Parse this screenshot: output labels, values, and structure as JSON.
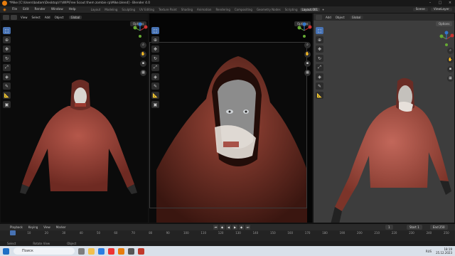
{
  "titlebar": {
    "title": "*Mike [C:\\Users\\badam\\Desktop\\!!\\WIP\\Free Scout them zombie rp\\Mike.blend] - Blender 4.0"
  },
  "menubar": {
    "items": [
      "File",
      "Edit",
      "Render",
      "Window",
      "Help"
    ],
    "workspaces": [
      "Layout",
      "Modeling",
      "Sculpting",
      "UV Editing",
      "Texture Paint",
      "Shading",
      "Animation",
      "Rendering",
      "Compositing",
      "Geometry Nodes",
      "Scripting",
      "Layout.001"
    ],
    "active_workspace": "Layout.001",
    "scene": "Scene",
    "view_layer": "ViewLayer"
  },
  "viewport_header": {
    "items": [
      "View",
      "Select",
      "Add",
      "Object"
    ],
    "orientation": "Global",
    "options": "Options"
  },
  "timeline": {
    "menu": [
      "Playback",
      "Keying",
      "View",
      "Marker"
    ],
    "current_frame": "1",
    "start_label": "Start",
    "start_value": "1",
    "end_label": "End",
    "end_value": "250",
    "ticks": [
      "0",
      "10",
      "20",
      "30",
      "40",
      "50",
      "60",
      "70",
      "80",
      "90",
      "100",
      "110",
      "120",
      "130",
      "140",
      "150",
      "160",
      "170",
      "180",
      "190",
      "200",
      "210",
      "220",
      "230",
      "240",
      "250"
    ]
  },
  "statusbar": {
    "items": [
      "Select",
      "Rotate View",
      "Object"
    ]
  },
  "taskbar": {
    "search": "Поиск",
    "lang": "RUS",
    "time": "18:19",
    "date": "25.12.2023"
  },
  "colors": {
    "accent": "#4772b3",
    "blender_orange": "#e87d0d",
    "hoodie": "#a0493d"
  }
}
